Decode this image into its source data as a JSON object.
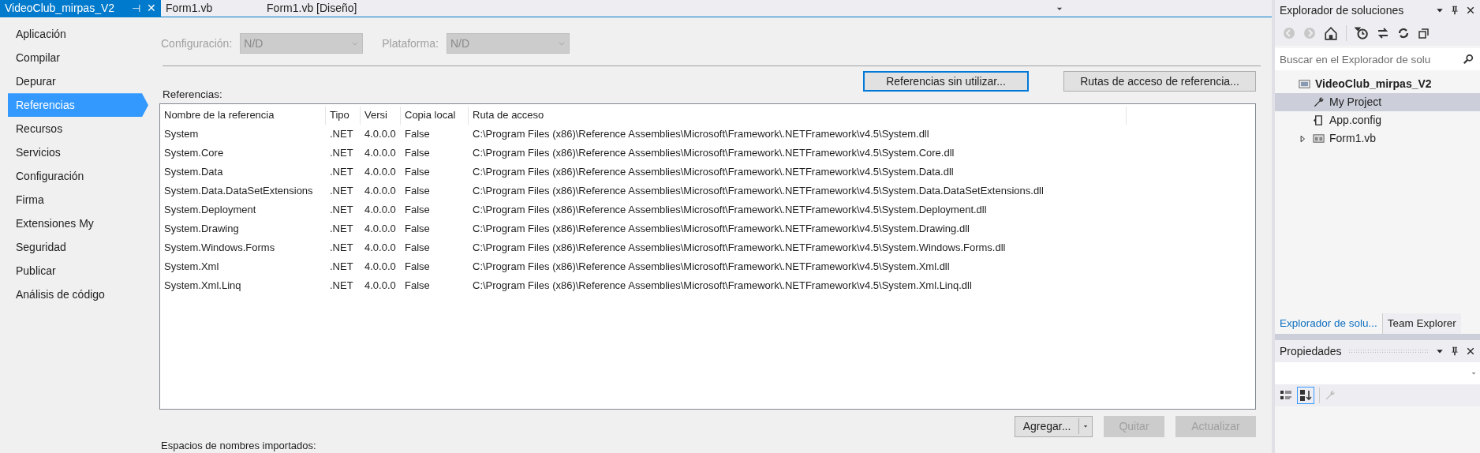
{
  "document_tabs": [
    {
      "label": "VideoClub_mirpas_V2",
      "selected": true,
      "pin": "⊣",
      "close": "✕"
    },
    {
      "label": "Form1.vb",
      "selected": false
    },
    {
      "label": "Form1.vb [Diseño]",
      "selected": false
    }
  ],
  "nav": [
    {
      "label": "Aplicación",
      "selected": false
    },
    {
      "label": "Compilar",
      "selected": false
    },
    {
      "label": "Depurar",
      "selected": false
    },
    {
      "label": "Referencias",
      "selected": true
    },
    {
      "label": "Recursos",
      "selected": false
    },
    {
      "label": "Servicios",
      "selected": false
    },
    {
      "label": "Configuración",
      "selected": false
    },
    {
      "label": "Firma",
      "selected": false
    },
    {
      "label": "Extensiones My",
      "selected": false
    },
    {
      "label": "Seguridad",
      "selected": false
    },
    {
      "label": "Publicar",
      "selected": false
    },
    {
      "label": "Análisis de código",
      "selected": false
    }
  ],
  "configuration": {
    "label": "Configuración:",
    "value": "N/D",
    "disabled": true
  },
  "platform": {
    "label": "Plataforma:",
    "value": "N/D",
    "disabled": true
  },
  "buttons_top": [
    {
      "label": "Referencias sin utilizar...",
      "focused": true
    },
    {
      "label": "Rutas de acceso de referencia...",
      "focused": false
    }
  ],
  "references_label": "Referencias:",
  "table": {
    "columns": [
      "Nombre de la referencia",
      "Tipo",
      "Versi",
      "Copia local",
      "Ruta de acceso"
    ],
    "rows": [
      [
        "System",
        ".NET",
        "4.0.0.0",
        "False",
        "C:\\Program Files (x86)\\Reference Assemblies\\Microsoft\\Framework\\.NETFramework\\v4.5\\System.dll"
      ],
      [
        "System.Core",
        ".NET",
        "4.0.0.0",
        "False",
        "C:\\Program Files (x86)\\Reference Assemblies\\Microsoft\\Framework\\.NETFramework\\v4.5\\System.Core.dll"
      ],
      [
        "System.Data",
        ".NET",
        "4.0.0.0",
        "False",
        "C:\\Program Files (x86)\\Reference Assemblies\\Microsoft\\Framework\\.NETFramework\\v4.5\\System.Data.dll"
      ],
      [
        "System.Data.DataSetExtensions",
        ".NET",
        "4.0.0.0",
        "False",
        "C:\\Program Files (x86)\\Reference Assemblies\\Microsoft\\Framework\\.NETFramework\\v4.5\\System.Data.DataSetExtensions.dll"
      ],
      [
        "System.Deployment",
        ".NET",
        "4.0.0.0",
        "False",
        "C:\\Program Files (x86)\\Reference Assemblies\\Microsoft\\Framework\\.NETFramework\\v4.5\\System.Deployment.dll"
      ],
      [
        "System.Drawing",
        ".NET",
        "4.0.0.0",
        "False",
        "C:\\Program Files (x86)\\Reference Assemblies\\Microsoft\\Framework\\.NETFramework\\v4.5\\System.Drawing.dll"
      ],
      [
        "System.Windows.Forms",
        ".NET",
        "4.0.0.0",
        "False",
        "C:\\Program Files (x86)\\Reference Assemblies\\Microsoft\\Framework\\.NETFramework\\v4.5\\System.Windows.Forms.dll"
      ],
      [
        "System.Xml",
        ".NET",
        "4.0.0.0",
        "False",
        "C:\\Program Files (x86)\\Reference Assemblies\\Microsoft\\Framework\\.NETFramework\\v4.5\\System.Xml.dll"
      ],
      [
        "System.Xml.Linq",
        ".NET",
        "4.0.0.0",
        "False",
        "C:\\Program Files (x86)\\Reference Assemblies\\Microsoft\\Framework\\.NETFramework\\v4.5\\System.Xml.Linq.dll"
      ]
    ]
  },
  "buttons_bottom": [
    {
      "label": "Agregar...",
      "disabled": false,
      "split": true
    },
    {
      "label": "Quitar",
      "disabled": true,
      "split": false
    },
    {
      "label": "Actualizar",
      "disabled": true,
      "split": false
    }
  ],
  "imports_label": "Espacios de nombres importados:",
  "solution_explorer": {
    "title": "Explorador de soluciones",
    "search": {
      "placeholder": "Buscar en el Explorador de solu"
    },
    "tree": [
      {
        "label": "VideoClub_mirpas_V2",
        "kind": "project",
        "selected": false,
        "children": [
          {
            "label": "My Project",
            "kind": "settings",
            "selected": true
          },
          {
            "label": "App.config",
            "kind": "config",
            "selected": false
          },
          {
            "label": "Form1.vb",
            "kind": "form",
            "selected": false,
            "expanded": false
          }
        ]
      }
    ],
    "tabs": [
      {
        "label": "Explorador de solu...",
        "selected": true
      },
      {
        "label": "Team Explorer",
        "selected": false
      }
    ]
  },
  "properties": {
    "title": "Propiedades"
  }
}
